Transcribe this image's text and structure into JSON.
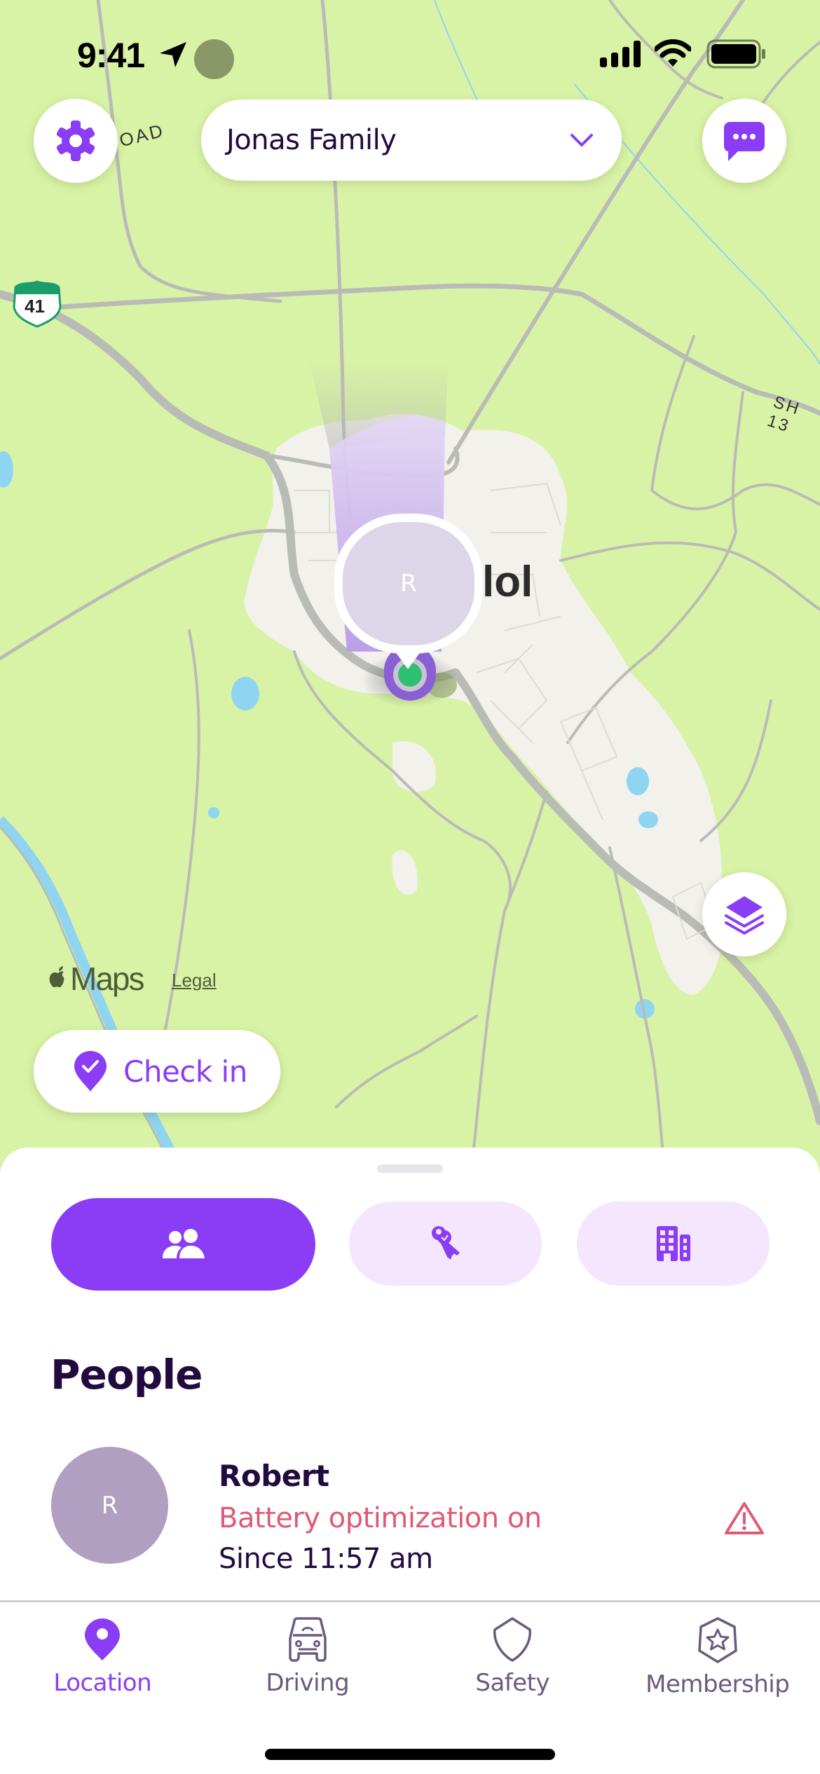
{
  "status_bar": {
    "time": "9:41"
  },
  "header": {
    "group_name": "Jonas Family",
    "settings_icon": "gear-icon",
    "chat_icon": "chat-bubble-icon",
    "dropdown_icon": "chevron-down-icon"
  },
  "map": {
    "town_label": "lol",
    "road_labels": [
      "OAD",
      "SH 13"
    ],
    "highway_shield": "41",
    "attribution": "Maps",
    "legal_link": "Legal",
    "member_marker_initial": "R",
    "layers_icon": "layers-icon"
  },
  "check_in": {
    "label": "Check in",
    "icon": "pin-check-icon"
  },
  "sheet": {
    "segments": [
      {
        "icon": "people-icon",
        "active": true
      },
      {
        "icon": "keys-icon",
        "active": false
      },
      {
        "icon": "building-icon",
        "active": false
      }
    ],
    "section_title": "People",
    "people": [
      {
        "initial": "R",
        "name": "Robert",
        "status": "Battery optimization on",
        "since": "Since 11:57 am",
        "alert_icon": "warning-icon"
      }
    ]
  },
  "tab_bar": {
    "tabs": [
      {
        "label": "Location",
        "icon": "location-pin-icon",
        "active": true
      },
      {
        "label": "Driving",
        "icon": "car-icon",
        "active": false
      },
      {
        "label": "Safety",
        "icon": "shield-icon",
        "active": false
      },
      {
        "label": "Membership",
        "icon": "star-badge-icon",
        "active": false
      }
    ]
  },
  "colors": {
    "accent": "#8b3df5",
    "accent_light": "#f3e6fe",
    "text_dark": "#220a3f",
    "alert": "#e05a75",
    "map_land": "#d9f3a6",
    "member_online": "#2fbf71"
  }
}
